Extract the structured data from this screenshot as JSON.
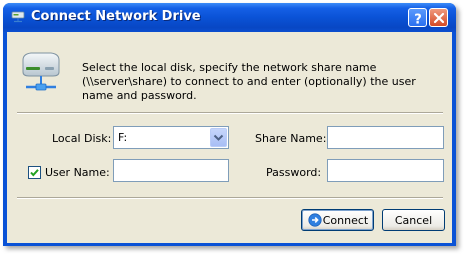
{
  "window": {
    "title": "Connect Network Drive",
    "icon": "network-drive-icon",
    "controls": {
      "help": "help-icon",
      "close": "close-icon"
    }
  },
  "description": "Select the local disk, specify the network share name (\\\\server\\share) to connect to and enter (optionally) the user name and password.",
  "form": {
    "local_disk": {
      "label": "Local Disk:",
      "value": "F:"
    },
    "share_name": {
      "label": "Share Name:",
      "value": ""
    },
    "user_name": {
      "label": "User Name:",
      "value": "",
      "checked": true
    },
    "password": {
      "label": "Password:",
      "value": ""
    }
  },
  "buttons": {
    "connect": {
      "label": "Connect",
      "icon": "arrow-right-circle-icon"
    },
    "cancel": {
      "label": "Cancel"
    }
  },
  "colors": {
    "titlebar": "#0a52d6",
    "dialog_bg": "#ece9d8",
    "field_border": "#7f9db9",
    "close_button": "#d44a26"
  }
}
